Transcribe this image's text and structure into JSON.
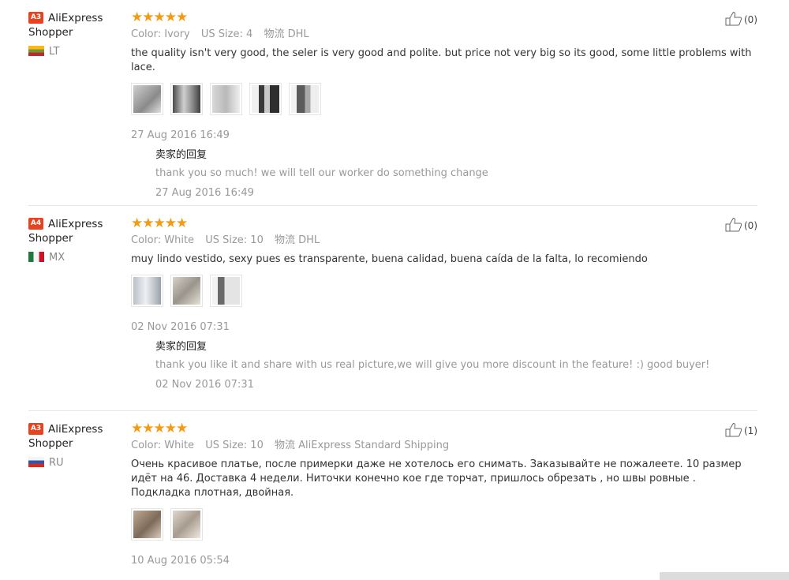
{
  "reviews": [
    {
      "level": "A3",
      "user": "AliExpress Shopper",
      "user_line1": "AliExpress",
      "user_line2": "Shopper",
      "country": "LT",
      "rating": 5,
      "stars": "★★★★★",
      "color_label": "Color:",
      "color": "Ivory",
      "size_label": "US Size:",
      "size": "4",
      "shipping_label": "物流",
      "shipping": "DHL",
      "text": "the quality isn't very good, the seler is very good and polite. but price not very big so its good, some little problems with lace.",
      "photos": 5,
      "date": "27 Aug 2016 16:49",
      "helpful": "(0)",
      "reply": {
        "title": "卖家的回复",
        "text": "thank you so much! we will tell our worker do something change",
        "date": "27 Aug 2016 16:49"
      }
    },
    {
      "level": "A4",
      "user": "AliExpress Shopper",
      "user_line1": "AliExpress",
      "user_line2": "Shopper",
      "country": "MX",
      "rating": 5,
      "stars": "★★★★★",
      "color_label": "Color:",
      "color": "White",
      "size_label": "US Size:",
      "size": "10",
      "shipping_label": "物流",
      "shipping": "DHL",
      "text": "muy lindo vestido, sexy pues es transparente, buena calidad, buena caída de la falta, lo recomiendo",
      "photos": 3,
      "date": "02 Nov 2016 07:31",
      "helpful": "(0)",
      "reply": {
        "title": "卖家的回复",
        "text": "thank you like it and share with us real picture,we will give you more discount in the feature! :) good buyer!",
        "date": "02 Nov 2016 07:31"
      }
    },
    {
      "level": "A3",
      "user": "AliExpress Shopper",
      "user_line1": "AliExpress",
      "user_line2": "Shopper",
      "country": "RU",
      "rating": 5,
      "stars": "★★★★★",
      "color_label": "Color:",
      "color": "White",
      "size_label": "US Size:",
      "size": "10",
      "shipping_label": "物流",
      "shipping": "AliExpress Standard Shipping",
      "text": "Очень красивое платье, после примерки даже не хотелось его снимать. Заказывайте не пожалеете. 10 размер идёт на 46. Доставка 4 недели. Ниточки конечно кое где торчат, пришлось обрезать , но швы ровные . Подкладка плотная, двойная.",
      "photos": 2,
      "date": "10 Aug 2016 05:54",
      "helpful": "(1)"
    }
  ],
  "colors": {
    "badge": "#e8421f",
    "stars": "#f49a13",
    "muted": "#999999"
  }
}
